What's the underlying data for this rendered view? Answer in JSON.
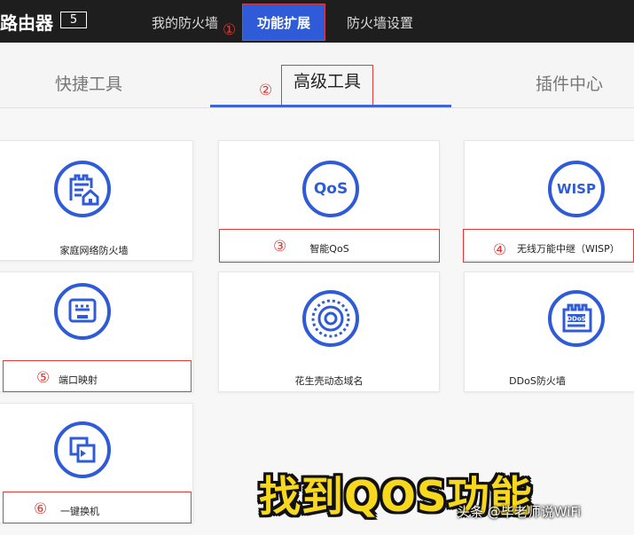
{
  "header": {
    "brand": "路由器",
    "version_badge": "5",
    "nav": [
      {
        "label": "我的防火墙",
        "marker": "①"
      },
      {
        "label": "功能扩展"
      },
      {
        "label": "防火墙设置"
      }
    ]
  },
  "subtabs": [
    {
      "label": "快捷工具"
    },
    {
      "label": "高级工具",
      "marker": "②"
    },
    {
      "label": "插件中心"
    }
  ],
  "tools": [
    {
      "label": "家庭网络防火墙",
      "icon": "home-firewall-icon"
    },
    {
      "label": "智能QoS",
      "icon": "qos-icon",
      "icon_text": "QoS",
      "marker": "③"
    },
    {
      "label": "无线万能中继（WISP）",
      "icon": "wisp-icon",
      "icon_text": "WISP",
      "marker": "④"
    },
    {
      "label": "端口映射",
      "icon": "port-mapping-icon",
      "marker": "⑤"
    },
    {
      "label": "花生壳动态域名",
      "icon": "oray-dns-icon"
    },
    {
      "label": "DDoS防火墙",
      "icon": "ddos-firewall-icon",
      "icon_text": "DDoS"
    },
    {
      "label": "一键换机",
      "icon": "one-click-migrate-icon",
      "marker": "⑥"
    }
  ],
  "overlay": {
    "caption": "找到QOS功能",
    "watermark": "头条 @毕老师说WiFi"
  },
  "colors": {
    "accent": "#2f5bd8",
    "highlight": "#e53935",
    "caption": "#f7d81c"
  }
}
